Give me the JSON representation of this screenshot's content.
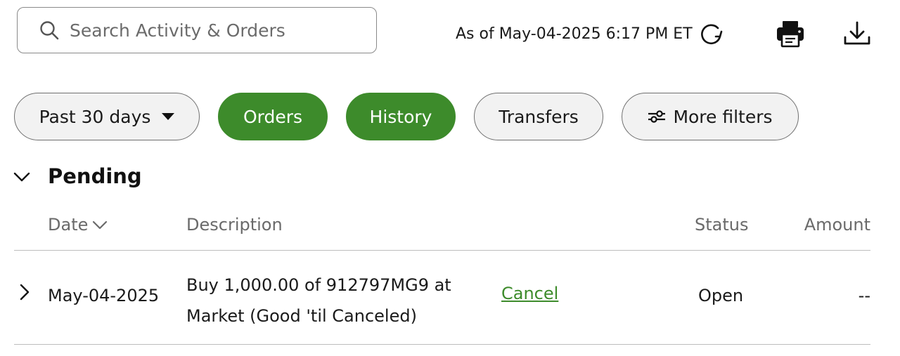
{
  "search": {
    "placeholder": "Search Activity & Orders"
  },
  "header": {
    "as_of": "As of May-04-2025 6:17 PM ET",
    "refresh_icon": "refresh-icon",
    "print_icon": "print-icon",
    "download_icon": "download-icon"
  },
  "filters": {
    "range_label": "Past 30 days",
    "orders_label": "Orders",
    "history_label": "History",
    "transfers_label": "Transfers",
    "more_label": "More filters"
  },
  "section": {
    "title": "Pending"
  },
  "table": {
    "headers": {
      "date": "Date",
      "description": "Description",
      "status": "Status",
      "amount": "Amount"
    },
    "rows": [
      {
        "date": "May-04-2025",
        "description_line1": "Buy 1,000.00 of 912797MG9 at",
        "description_line2": "Market (Good 'til Canceled)",
        "action": "Cancel",
        "status": "Open",
        "amount": "--"
      }
    ]
  },
  "colors": {
    "accent": "#3d8b2b",
    "border": "#8a8a8a",
    "muted_text": "#6a6a6a"
  }
}
